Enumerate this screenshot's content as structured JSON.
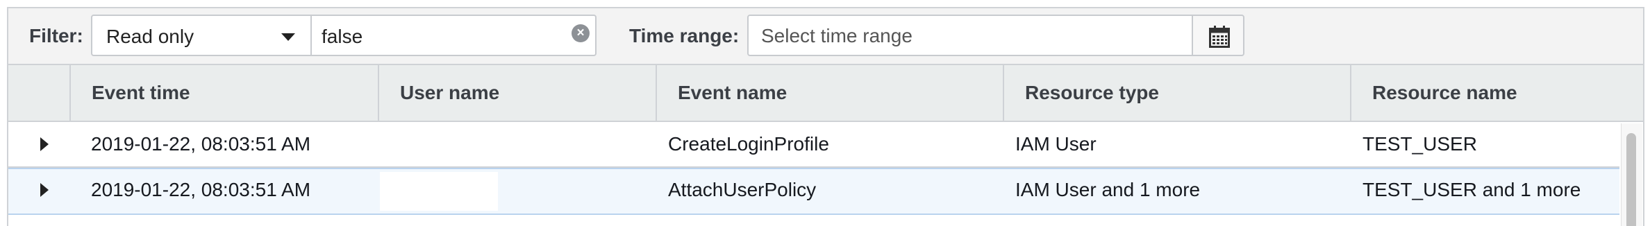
{
  "filter": {
    "label": "Filter:",
    "attribute_selected": "Read only",
    "value": "false"
  },
  "time_range": {
    "label": "Time range:",
    "placeholder": "Select time range"
  },
  "table": {
    "columns": [
      "Event time",
      "User name",
      "Event name",
      "Resource type",
      "Resource name"
    ],
    "rows": [
      {
        "event_time": "2019-01-22, 08:03:51 AM",
        "user_name": "",
        "event_name": "CreateLoginProfile",
        "resource_type": "IAM User",
        "resource_name": "TEST_USER"
      },
      {
        "event_time": "2019-01-22, 08:03:51 AM",
        "user_name": "",
        "event_name": "AttachUserPolicy",
        "resource_type": "IAM User and 1 more",
        "resource_name": "TEST_USER and 1 more"
      }
    ]
  },
  "icons": {
    "clear": "clear-icon",
    "calendar": "calendar-icon",
    "dropdown": "caret-down-icon",
    "expand": "expand-row-icon"
  },
  "colors": {
    "selected_row_bg": "#f1f7fd",
    "header_bg": "#eaeded",
    "toolbar_bg": "#f3f3f3"
  }
}
